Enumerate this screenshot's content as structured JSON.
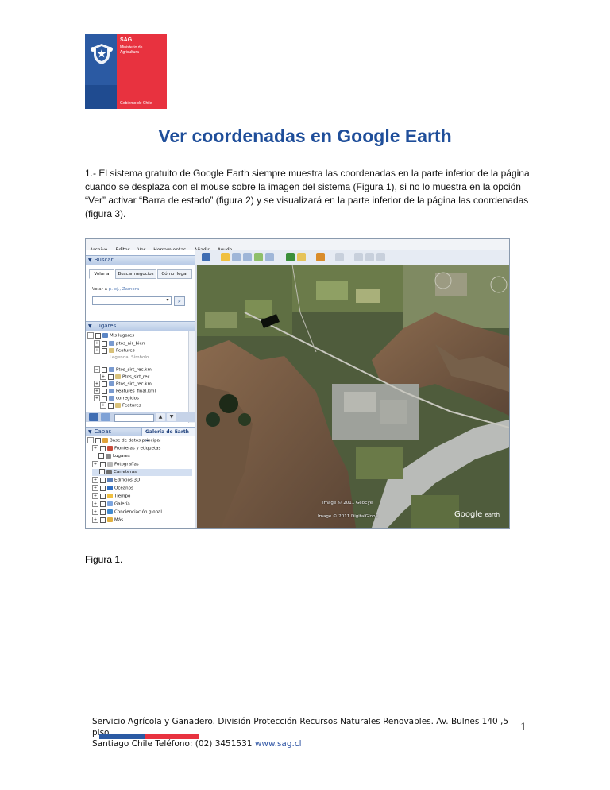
{
  "logo": {
    "name": "SAG",
    "ministry": "Ministerio de Agricultura",
    "government": "Gobierno de Chile",
    "colors": {
      "blue": "#2b5aa3",
      "red": "#e8323f"
    }
  },
  "title": "Ver coordenadas en Google Earth",
  "paragraph": "1.- El sistema gratuito de Google Earth siempre muestra las coordenadas en la parte inferior de la página cuando se desplaza con el mouse sobre la imagen del sistema (Figura 1), si no lo muestra en la opción “Ver” activar “Barra de estado” (figura 2) y se visualizará en la parte inferior de la página las coordenadas (figura 3).",
  "screenshot": {
    "menu": [
      "Archivo",
      "Editar",
      "Ver",
      "Herramientas",
      "Añadir",
      "Ayuda"
    ],
    "buscar_panel": {
      "title": "Buscar",
      "tabs": [
        "Volar a",
        "Buscar negocios",
        "Cómo llegar"
      ],
      "hint_label": "Volar a",
      "hint_example": "p. ej., Zamora",
      "input_value": ""
    },
    "lugares_panel": {
      "title": "Lugares",
      "items": [
        "Mis lugares",
        "ptos_air_bien",
        "Features",
        "Legenda: Símbolo",
        "Ptos_sirt_rec.kml",
        "Ptos_sirt_rec",
        "Ptos_sirt_rec.kml",
        "Features_final.kml",
        "corregidos",
        "Features"
      ]
    },
    "capas_panel": {
      "title": "Capas",
      "gallery_tab": "Galería de Earth »",
      "items": [
        "Base de datos principal",
        "Fronteras y etiquetas",
        "Lugares",
        "Fotografías",
        "Carreteras",
        "Edificios 3D",
        "Océanos",
        "Tiempo",
        "Galería",
        "Concienciación global",
        "Más"
      ]
    },
    "attribution_1": "Image © 2011 GeoEye",
    "attribution_2": "Image © 2011 DigitalGlobe",
    "brand_logo": "Google",
    "brand_logo_suffix": "earth"
  },
  "caption": "Figura 1.",
  "footer": {
    "line1": "Servicio Agrícola y Ganadero. División Protección Recursos Naturales Renovables. Av. Bulnes 140 ,5 piso,",
    "line2_prefix": "Santiago Chile Teléfono: (02) 3451531",
    "link": "www.sag.cl"
  },
  "page_number": "1"
}
